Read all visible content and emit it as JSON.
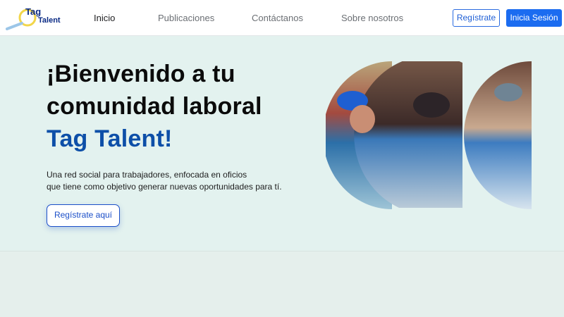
{
  "logo": {
    "line1": "Tag",
    "line2": "Talent"
  },
  "nav": {
    "links": [
      "Inicio",
      "Publicaciones",
      "Contáctanos",
      "Sobre nosotros"
    ],
    "register_label": "Regístrate",
    "login_label": "Inicia Sesión"
  },
  "hero": {
    "title_line1": "¡Bienvenido a tu",
    "title_line2": "comunidad laboral",
    "title_brand": "Tag Talent!",
    "desc_line1": "Una red social para trabajadores, enfocada en oficios",
    "desc_line2": "que tiene como objetivo generar nuevas oportunidades para tí.",
    "cta_label": "Regístrate aquí"
  },
  "colors": {
    "brand_blue": "#0d4fa8",
    "primary_button": "#1b6cf0",
    "hero_background": "#e3f2ef"
  },
  "icons": {
    "logo_mark": "magnifier-icon"
  }
}
